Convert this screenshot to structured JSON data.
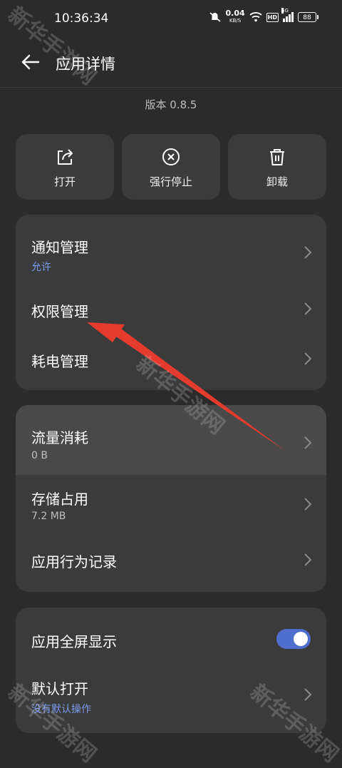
{
  "status_bar": {
    "time": "10:36:34",
    "net_speed": "0.04",
    "net_unit": "KB/S",
    "hd": "HD",
    "network": "5G",
    "battery": "88"
  },
  "header": {
    "title": "应用详情"
  },
  "version": "版本 0.8.5",
  "actions": [
    {
      "label": "打开",
      "icon": "share-open-icon"
    },
    {
      "label": "强行停止",
      "icon": "force-stop-icon"
    },
    {
      "label": "卸载",
      "icon": "trash-icon"
    }
  ],
  "card1": [
    {
      "title": "通知管理",
      "subtitle": "允许"
    },
    {
      "title": "权限管理"
    },
    {
      "title": "耗电管理"
    }
  ],
  "card2": [
    {
      "title": "流量消耗",
      "subtitle": "0 B"
    },
    {
      "title": "存储占用",
      "subtitle": "7.2 MB"
    },
    {
      "title": "应用行为记录"
    }
  ],
  "card3": [
    {
      "title": "应用全屏显示",
      "toggle_on": true
    },
    {
      "title": "默认打开",
      "subtitle": "没有默认操作"
    }
  ],
  "watermark": "新华手游网",
  "colors": {
    "background": "#2b2b2b",
    "card": "#3b3b3b",
    "accent_blue": "#7b9bf0",
    "toggle_on": "#4f6fcf",
    "annotation_red": "#e53a2e"
  }
}
